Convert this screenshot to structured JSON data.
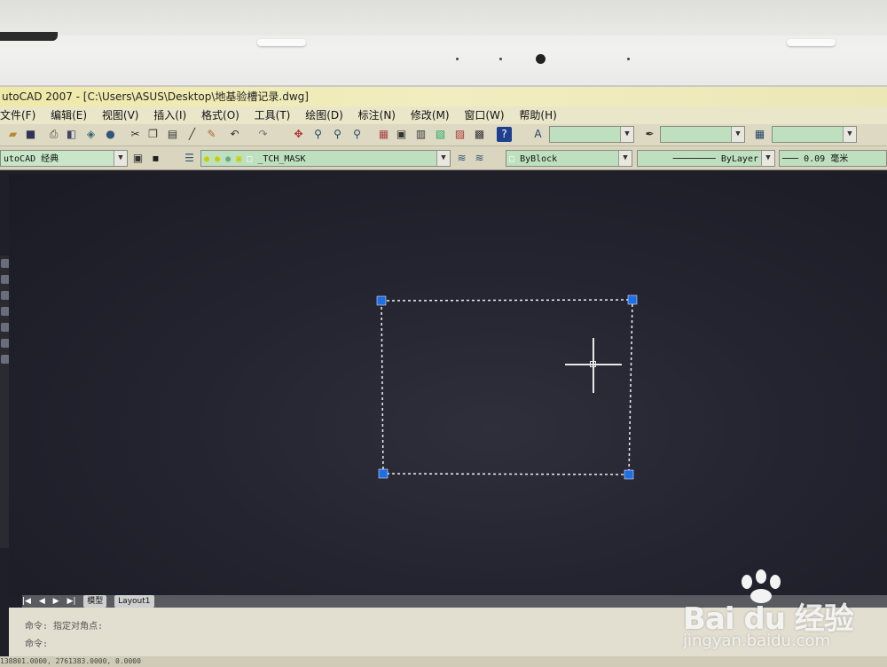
{
  "window": {
    "title": "utoCAD 2007 - [C:\\Users\\ASUS\\Desktop\\地基验槽记录.dwg]"
  },
  "menu": {
    "items": [
      "文件(F)",
      "编辑(E)",
      "视图(V)",
      "插入(I)",
      "格式(O)",
      "工具(T)",
      "绘图(D)",
      "标注(N)",
      "修改(M)",
      "窗口(W)",
      "帮助(H)"
    ]
  },
  "toolbar": {
    "workspace": "utoCAD 经典",
    "layer": "_TCH_MASK",
    "color": "ByBlock",
    "linetype": "ByLayer",
    "lineweight": "0.09 毫米"
  },
  "tabs": {
    "model": "模型",
    "layout": "Layout1"
  },
  "command": {
    "line1": "命令: 指定对角点:",
    "line2": "命令:"
  },
  "status": {
    "coords": "138801.0000, 2761383.0000, 0.0000"
  },
  "watermark": {
    "brand": "Bai du 经验",
    "url": "jingyan.baidu.com"
  },
  "icons": {
    "cursor": "crosshair-icon",
    "grips": "grip-handle-icon"
  },
  "colors": {
    "canvas": "#24242f",
    "grip": "#1e6ee6",
    "titlebar": "#efe9a8"
  }
}
